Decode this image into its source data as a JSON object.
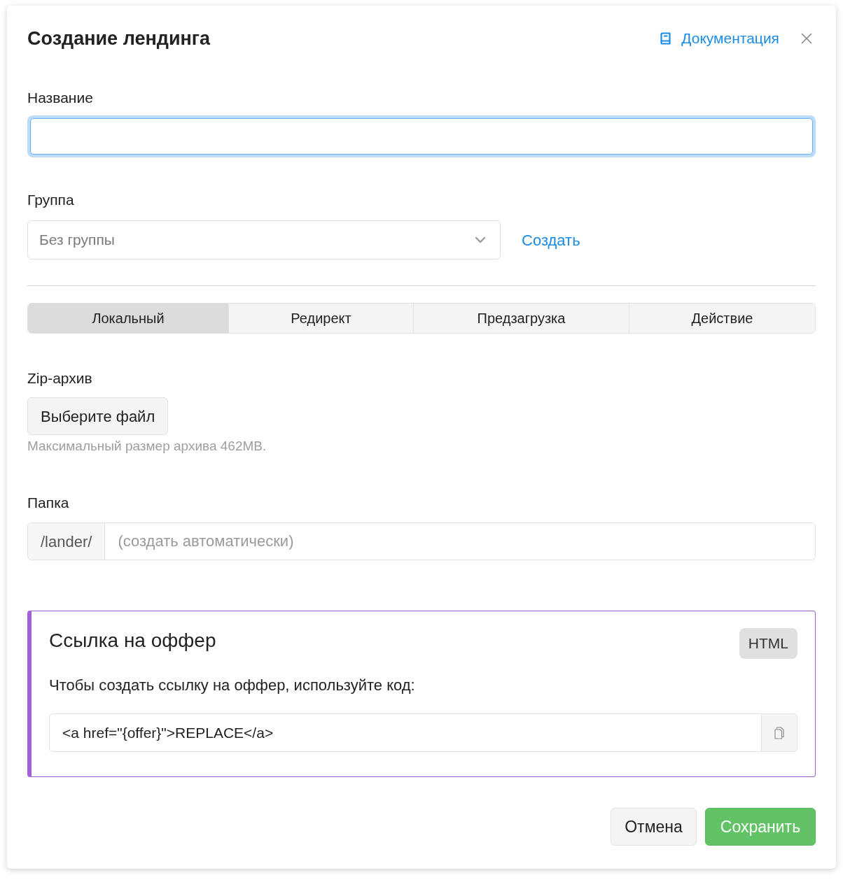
{
  "dialog": {
    "title": "Создание лендинга",
    "documentation_link": "Документация"
  },
  "name_field": {
    "label": "Название",
    "focused": true
  },
  "group": {
    "label": "Группа",
    "placeholder": "Без группы",
    "create_link": "Создать"
  },
  "tabs": [
    {
      "label": "Локальный",
      "selected": true
    },
    {
      "label": "Редирект",
      "selected": false
    },
    {
      "label": "Предзагрузка",
      "selected": false
    },
    {
      "label": "Действие",
      "selected": false
    }
  ],
  "archive": {
    "label": "Zip-архив",
    "button": "Выберите файл",
    "hint": "Максимальный размер архива 462MB."
  },
  "folder": {
    "label": "Папка",
    "prefix": "/lander/",
    "placeholder": "(создать автоматически)"
  },
  "offer_link": {
    "title": "Ссылка на оффер",
    "badge": "HTML",
    "description": "Чтобы создать ссылку на оффер, используйте код:",
    "code": "<a href=\"{offer}\">REPLACE</a>"
  },
  "buttons": [
    {
      "label": "Отмена",
      "kind": "secondary"
    },
    {
      "label": "Сохранить",
      "kind": "primary"
    }
  ]
}
